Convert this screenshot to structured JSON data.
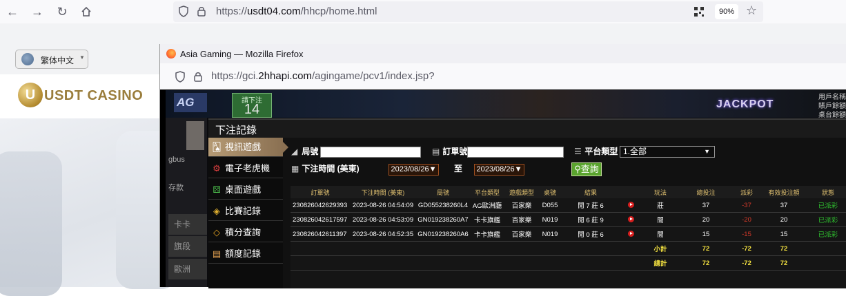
{
  "browser": {
    "url_prefix": "https://",
    "url_domain": "usdt04.com",
    "url_path": "/hhcp/home.html",
    "zoom": "90%"
  },
  "page": {
    "language": "繁体中文",
    "logo_text": "USDT CASINO",
    "logo_mark": "U"
  },
  "popup": {
    "window_title": "Asia Gaming — Mozilla Firefox",
    "url_prefix": "https://gci.",
    "url_domain": "2hhapi.com",
    "url_path": "/agingame/pcv1/index.jsp?"
  },
  "game": {
    "logo": "AG",
    "bet_label": "請下注",
    "bet_count": "14",
    "jackpot": "JACKPOT",
    "right_info": [
      "用戶名稱",
      "賬戶餘額",
      "桌台餘額"
    ],
    "side_texts": [
      "gbus",
      "存款",
      "卡卡",
      "旗段",
      "歐洲"
    ]
  },
  "modal": {
    "title": "下注記錄",
    "menu": [
      {
        "label": "視訊遊戲",
        "icon": "cards-icon",
        "glyph": "🂡",
        "active": true
      },
      {
        "label": "電子老虎機",
        "icon": "slot-machine-icon",
        "glyph": "⚙",
        "active": false
      },
      {
        "label": "桌面遊戲",
        "icon": "dice-icon",
        "glyph": "⚄",
        "active": false
      },
      {
        "label": "比賽記錄",
        "icon": "ticket-icon",
        "glyph": "◈",
        "active": false
      },
      {
        "label": "積分查詢",
        "icon": "diamond-icon",
        "glyph": "◇",
        "active": false
      },
      {
        "label": "額度記錄",
        "icon": "document-icon",
        "glyph": "▤",
        "active": false
      }
    ],
    "filters": {
      "round_label": "局號",
      "order_label": "訂單號",
      "platform_label": "平台類型",
      "platform_value": "1.全部",
      "time_label": "下注時間 (美東)",
      "date_from": "2023/08/26",
      "to_label": "至",
      "date_to": "2023/08/26",
      "query_label": "查詢"
    },
    "table": {
      "headers": [
        "訂單號",
        "下注時間 (美東)",
        "局號",
        "平台類型",
        "遊戲類型",
        "桌號",
        "結果",
        "",
        "玩法",
        "總投注",
        "派彩",
        "有效投注額",
        "狀態"
      ],
      "rows": [
        [
          "230826042629393",
          "2023-08-26 04:54:09",
          "GD055238260L4",
          "AG歐洲廳",
          "百家樂",
          "D055",
          "閒 7 莊 6",
          "",
          "莊",
          "37",
          "-37",
          "37",
          "已派彩"
        ],
        [
          "230826042617597",
          "2023-08-26 04:53:09",
          "GN019238260A7",
          "卡卡旗艦",
          "百家樂",
          "N019",
          "閒 6 莊 9",
          "",
          "閒",
          "20",
          "-20",
          "20",
          "已派彩"
        ],
        [
          "230826042611397",
          "2023-08-26 04:52:35",
          "GN019238260A6",
          "卡卡旗艦",
          "百家樂",
          "N019",
          "閒 0 莊 6",
          "",
          "閒",
          "15",
          "-15",
          "15",
          "已派彩"
        ]
      ],
      "subtotal": {
        "label": "小計",
        "total": "72",
        "payout": "-72",
        "valid": "72"
      },
      "grand_total": {
        "label": "總計",
        "total": "72",
        "payout": "-72",
        "valid": "72"
      }
    }
  }
}
